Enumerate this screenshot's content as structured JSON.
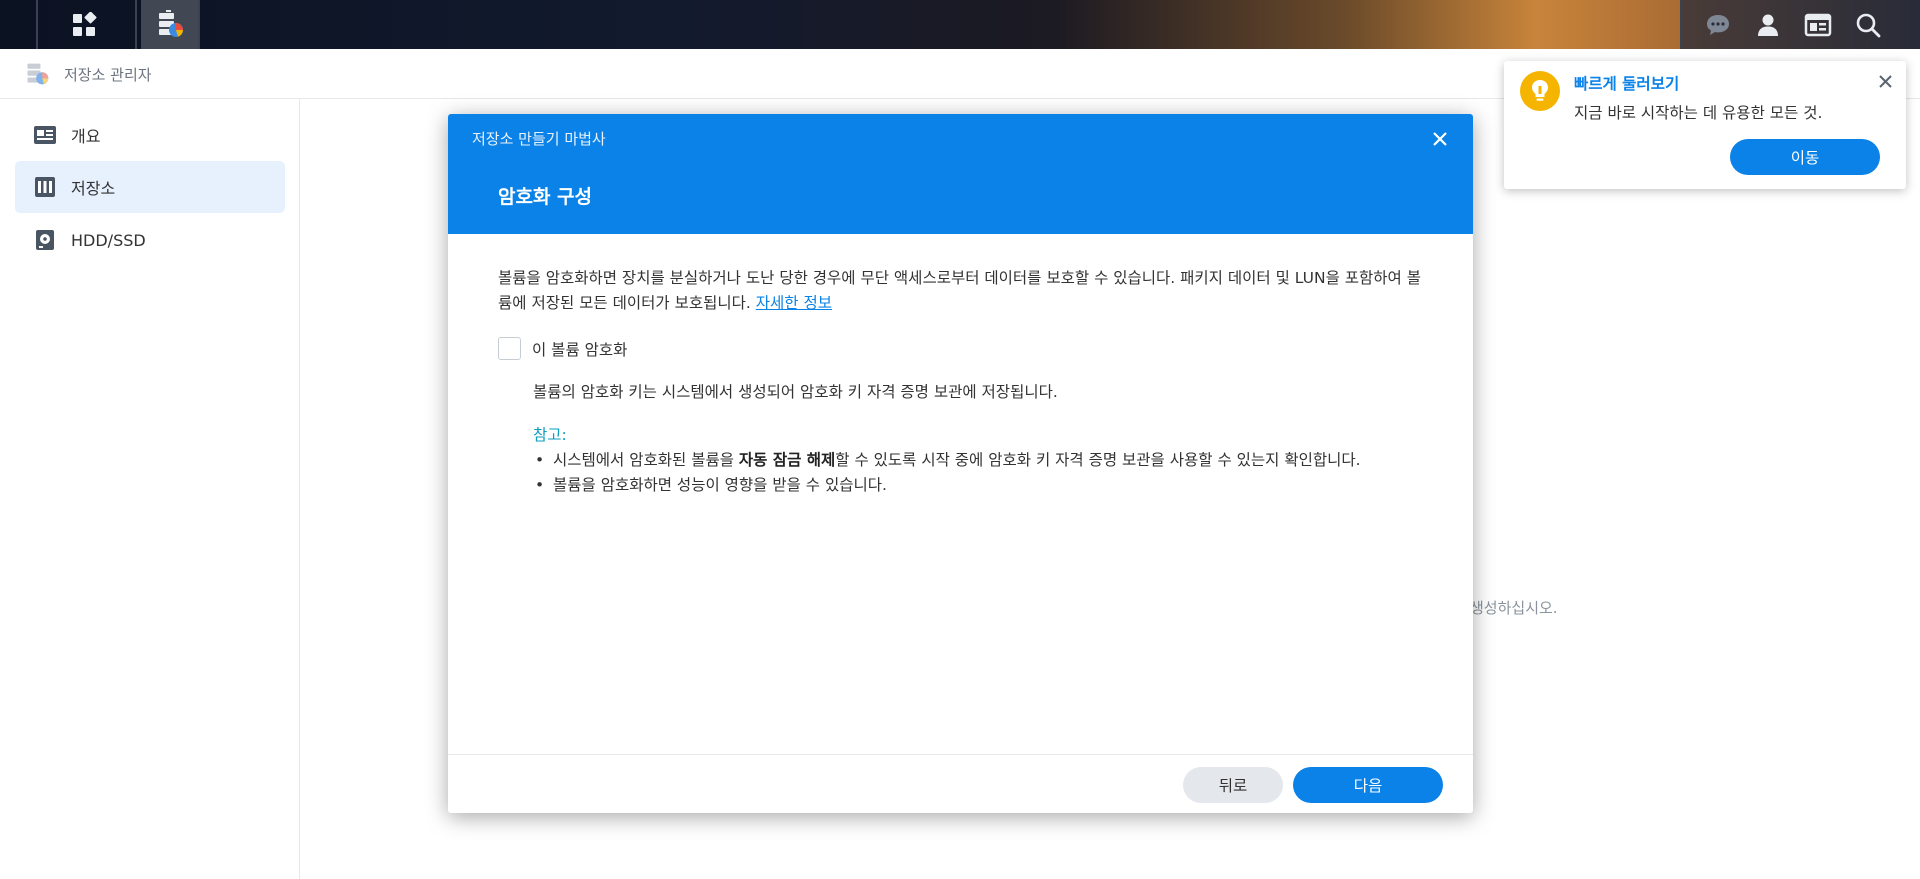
{
  "taskbar": {
    "icons": [
      "main-menu-icon",
      "storage-manager-app-icon",
      "chat-icon",
      "user-icon",
      "widgets-icon",
      "search-icon"
    ]
  },
  "app": {
    "title": "저장소 관리자",
    "bg_hint": "생성하십시오."
  },
  "sidebar": {
    "items": [
      {
        "label": "개요",
        "icon": "overview-icon"
      },
      {
        "label": "저장소",
        "icon": "storage-icon",
        "active": true
      },
      {
        "label": "HDD/SSD",
        "icon": "disk-icon"
      }
    ]
  },
  "modal": {
    "wizard_title": "저장소 만들기 마법사",
    "step_title": "암호화 구성",
    "description": "볼륨을 암호화하면 장치를 분실하거나 도난 당한 경우에 무단 액세스로부터 데이터를 보호할 수 있습니다. 패키지 데이터 및 LUN을 포함하여 볼륨에 저장된 모든 데이터가 보호됩니다.",
    "learn_more": "자세한 정보",
    "checkbox_label": "이 볼륨 암호화",
    "checkbox_checked": false,
    "key_note": "볼륨의 암호화 키는 시스템에서 생성되어 암호화 키 자격 증명 보관에 저장됩니다.",
    "note_title": "참고:",
    "note1_pre": "시스템에서 암호화된 볼륨을 ",
    "note1_bold": "자동 잠금 해제",
    "note1_post": "할 수 있도록 시작 중에 암호화 키 자격 증명 보관을 사용할 수 있는지 확인합니다.",
    "note2": "볼륨을 암호화하면 성능이 영향을 받을 수 있습니다.",
    "back_label": "뒤로",
    "next_label": "다음"
  },
  "tour": {
    "title": "빠르게 둘러보기",
    "text": "지금 바로 시작하는 데 유용한 모든 것.",
    "button_label": "이동"
  },
  "colors": {
    "accent": "#0a82e8",
    "note_title": "#0a9dbf",
    "tour_icon": "#f5b400",
    "sidebar_active": "#e6f1fd"
  }
}
